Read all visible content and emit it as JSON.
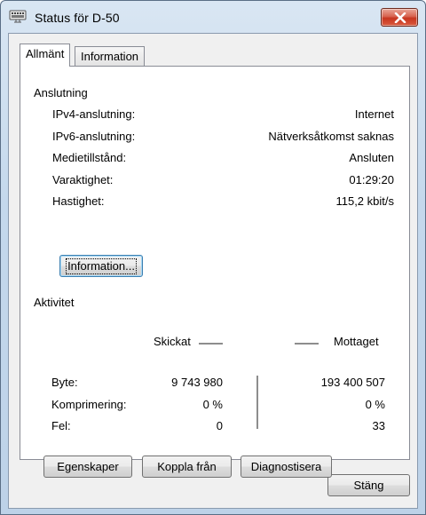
{
  "window": {
    "title": "Status för D-50"
  },
  "tabs": [
    {
      "label": "Allmänt",
      "active": true
    },
    {
      "label": "Information",
      "active": false
    }
  ],
  "connection": {
    "group_title": "Anslutning",
    "rows": [
      {
        "label": "IPv4-anslutning:",
        "value": "Internet"
      },
      {
        "label": "IPv6-anslutning:",
        "value": "Nätverksåtkomst saknas"
      },
      {
        "label": "Medietillstånd:",
        "value": "Ansluten"
      },
      {
        "label": "Varaktighet:",
        "value": "01:29:20"
      },
      {
        "label": "Hastighet:",
        "value": "115,2 kbit/s"
      }
    ],
    "details_button": "Information..."
  },
  "activity": {
    "group_title": "Aktivitet",
    "sent_label": "Skickat",
    "received_label": "Mottaget",
    "rows": [
      {
        "label": "Byte:",
        "sent": "9 743 980",
        "received": "193 400 507"
      },
      {
        "label": "Komprimering:",
        "sent": "0 %",
        "received": "0 %"
      },
      {
        "label": "Fel:",
        "sent": "0",
        "received": "33"
      }
    ]
  },
  "action_buttons": [
    {
      "label": "Egenskaper"
    },
    {
      "label": "Koppla från"
    },
    {
      "label": "Diagnostisera"
    }
  ],
  "close_button": "Stäng",
  "icons": {
    "title": "network-status-icon",
    "close": "close-icon",
    "activity": "network-computers-icon"
  },
  "colors": {
    "titlebar": "#c4d8ec",
    "close_button": "#c7361f",
    "panel": "#ffffff",
    "dialog": "#f0f0f0"
  }
}
